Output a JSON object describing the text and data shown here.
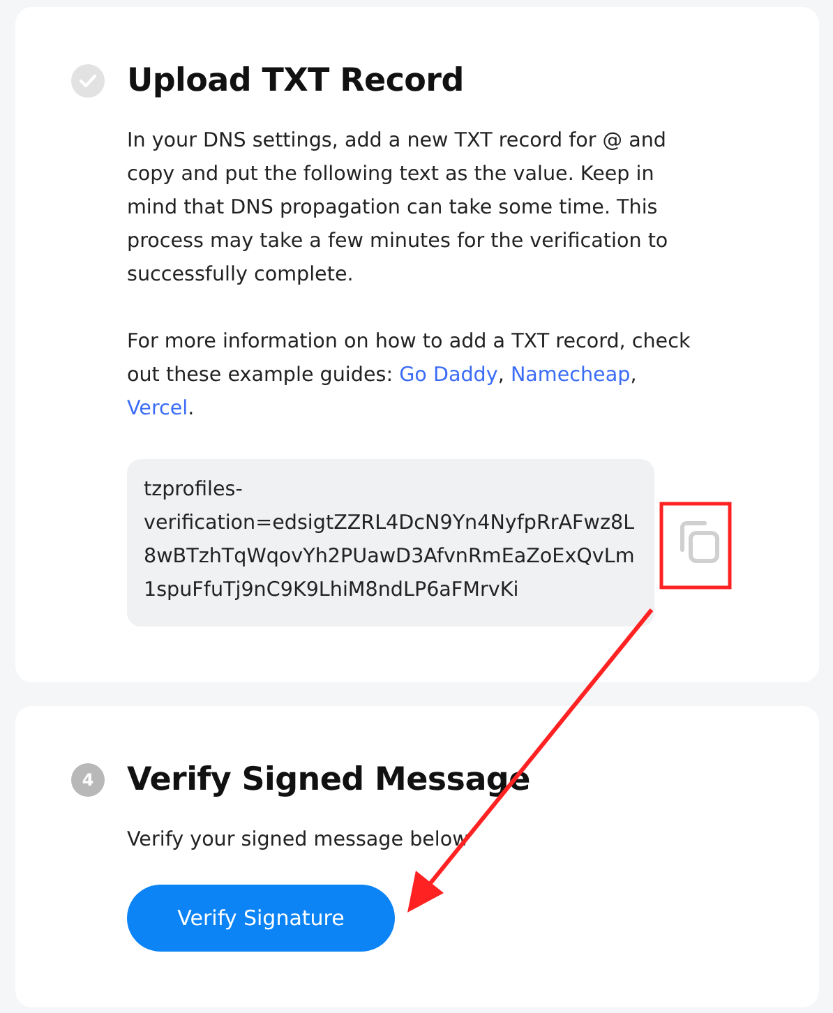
{
  "steps": [
    {
      "done": true,
      "title": "Upload TXT Record",
      "paragraphs": [
        [
          {
            "text": "In your DNS settings, add a new TXT record for @ and copy and put the following text as the value. Keep in mind that DNS propagation can take some time. This process may take a few minutes for the verification to successfully complete."
          }
        ],
        [
          {
            "text": "For more information on how to add a TXT record, check out these example guides: "
          },
          {
            "link": "Go Daddy"
          },
          {
            "text": ", "
          },
          {
            "link": "Namecheap"
          },
          {
            "text": ", "
          },
          {
            "link": "Vercel"
          },
          {
            "text": "."
          }
        ]
      ],
      "record": "tzprofiles-verification=edsigtZZRL4DcN9Yn4NyfpRrAFwz8L8wBTzhTqWqovYh2PUawD3AfvnRmEaZoExQvLm1spuFfuTj9nC9K9LhiM8ndLP6aFMrvKi"
    },
    {
      "done": false,
      "number": "4",
      "title": "Verify Signed Message",
      "paragraphs": [
        [
          {
            "text": "Verify your signed message below"
          }
        ]
      ],
      "button": "Verify Signature"
    }
  ]
}
